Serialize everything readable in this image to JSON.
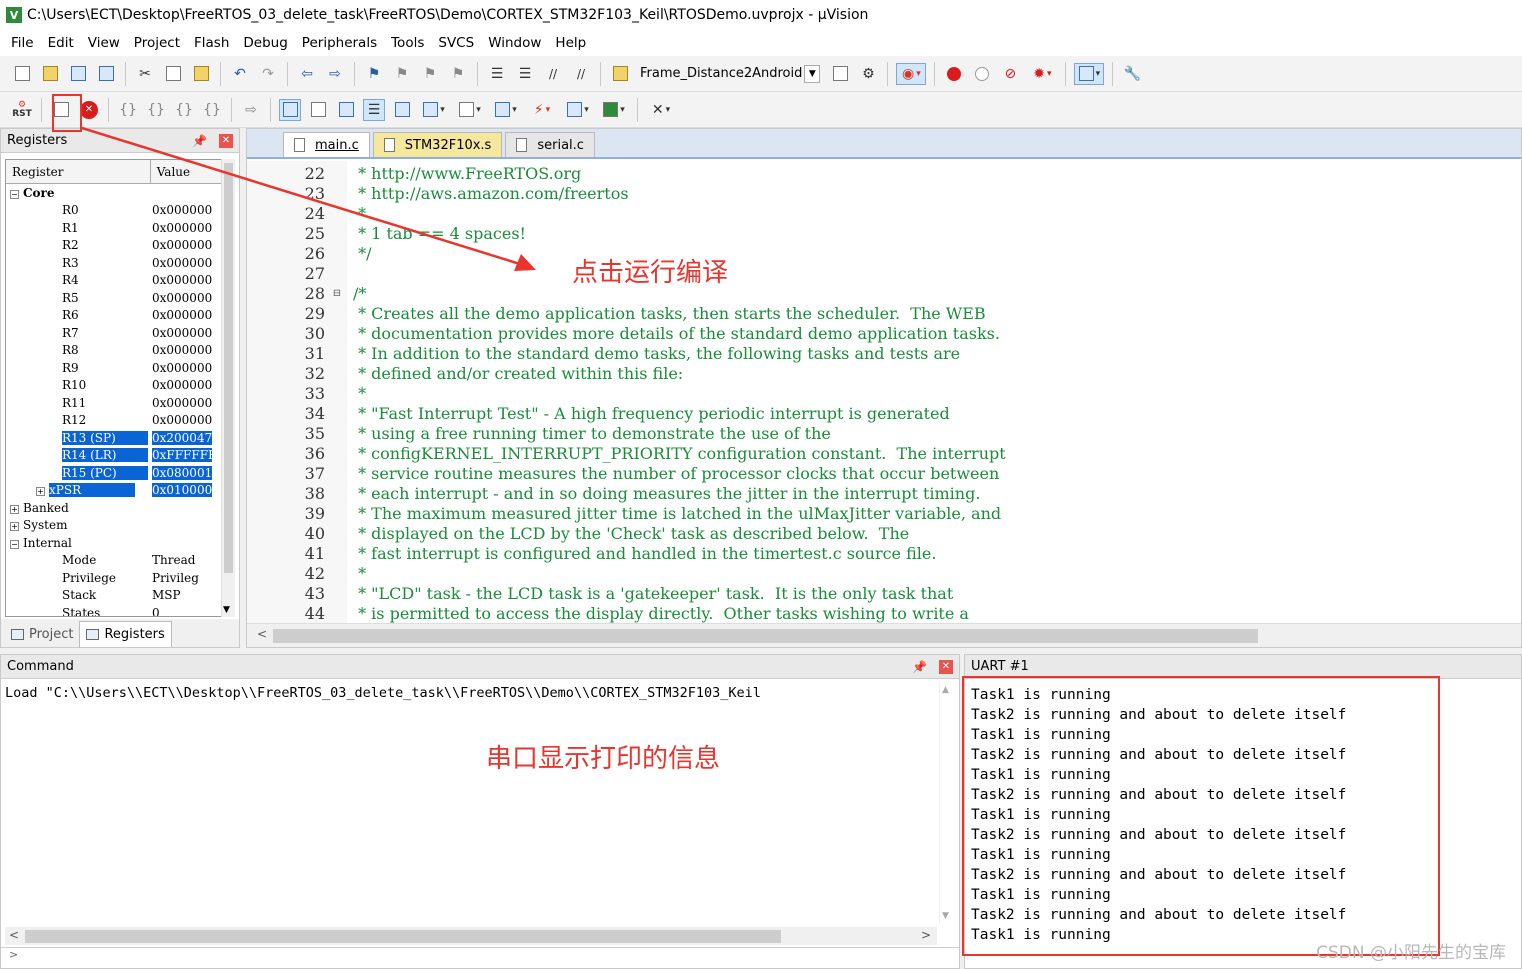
{
  "window": {
    "title": "C:\\Users\\ECT\\Desktop\\FreeRTOS_03_delete_task\\FreeRTOS\\Demo\\CORTEX_STM32F103_Keil\\RTOSDemo.uvprojx - µVision",
    "icon": "uvision-icon"
  },
  "menu": [
    "File",
    "Edit",
    "View",
    "Project",
    "Flash",
    "Debug",
    "Peripherals",
    "Tools",
    "SVCS",
    "Window",
    "Help"
  ],
  "toolbar": {
    "target": "Frame_Distance2Android",
    "rst_label": "RST"
  },
  "registers": {
    "panel_title": "Registers",
    "col_register": "Register",
    "col_value": "Value",
    "group_core": "Core",
    "core": [
      {
        "name": "R0",
        "value": "0x000000"
      },
      {
        "name": "R1",
        "value": "0x000000"
      },
      {
        "name": "R2",
        "value": "0x000000"
      },
      {
        "name": "R3",
        "value": "0x000000"
      },
      {
        "name": "R4",
        "value": "0x000000"
      },
      {
        "name": "R5",
        "value": "0x000000"
      },
      {
        "name": "R6",
        "value": "0x000000"
      },
      {
        "name": "R7",
        "value": "0x000000"
      },
      {
        "name": "R8",
        "value": "0x000000"
      },
      {
        "name": "R9",
        "value": "0x000000"
      },
      {
        "name": "R10",
        "value": "0x000000"
      },
      {
        "name": "R11",
        "value": "0x000000"
      },
      {
        "name": "R12",
        "value": "0x000000"
      },
      {
        "name": "R13 (SP)",
        "value": "0x200047"
      },
      {
        "name": "R14 (LR)",
        "value": "0xFFFFFF"
      },
      {
        "name": "R15 (PC)",
        "value": "0x080001"
      },
      {
        "name": "xPSR",
        "value": "0x010000"
      }
    ],
    "group_banked": "Banked",
    "group_system": "System",
    "group_internal": "Internal",
    "internal": [
      {
        "name": "Mode",
        "value": "Thread"
      },
      {
        "name": "Privilege",
        "value": "Privileg"
      },
      {
        "name": "Stack",
        "value": "MSP"
      },
      {
        "name": "States",
        "value": "0"
      }
    ],
    "tab_project": "Project",
    "tab_registers": "Registers"
  },
  "editor": {
    "tabs": [
      "main.c",
      "STM32F10x.s",
      "serial.c"
    ],
    "lines": [
      {
        "n": "22",
        "t": " * http://www.FreeRTOS.org"
      },
      {
        "n": "23",
        "t": " * http://aws.amazon.com/freertos"
      },
      {
        "n": "24",
        "t": " *"
      },
      {
        "n": "25",
        "t": " * 1 tab == 4 spaces!"
      },
      {
        "n": "26",
        "t": " */"
      },
      {
        "n": "27",
        "t": ""
      },
      {
        "n": "28",
        "t": "/*",
        "fold": "⊟"
      },
      {
        "n": "29",
        "t": " * Creates all the demo application tasks, then starts the scheduler.  The WEB"
      },
      {
        "n": "30",
        "t": " * documentation provides more details of the standard demo application tasks."
      },
      {
        "n": "31",
        "t": " * In addition to the standard demo tasks, the following tasks and tests are"
      },
      {
        "n": "32",
        "t": " * defined and/or created within this file:"
      },
      {
        "n": "33",
        "t": " *"
      },
      {
        "n": "34",
        "t": " * \"Fast Interrupt Test\" - A high frequency periodic interrupt is generated"
      },
      {
        "n": "35",
        "t": " * using a free running timer to demonstrate the use of the"
      },
      {
        "n": "36",
        "t": " * configKERNEL_INTERRUPT_PRIORITY configuration constant.  The interrupt"
      },
      {
        "n": "37",
        "t": " * service routine measures the number of processor clocks that occur between"
      },
      {
        "n": "38",
        "t": " * each interrupt - and in so doing measures the jitter in the interrupt timing."
      },
      {
        "n": "39",
        "t": " * The maximum measured jitter time is latched in the ulMaxJitter variable, and"
      },
      {
        "n": "40",
        "t": " * displayed on the LCD by the 'Check' task as described below.  The"
      },
      {
        "n": "41",
        "t": " * fast interrupt is configured and handled in the timertest.c source file."
      },
      {
        "n": "42",
        "t": " *"
      },
      {
        "n": "43",
        "t": " * \"LCD\" task - the LCD task is a 'gatekeeper' task.  It is the only task that"
      },
      {
        "n": "44",
        "t": " * is permitted to access the display directly.  Other tasks wishing to write a"
      }
    ]
  },
  "command": {
    "title": "Command",
    "text": "Load \"C:\\\\Users\\\\ECT\\\\Desktop\\\\FreeRTOS_03_delete_task\\\\FreeRTOS\\\\Demo\\\\CORTEX_STM32F103_Keil"
  },
  "uart": {
    "title": "UART #1",
    "lines": [
      "Task1 is running",
      "Task2 is running and about to delete itself",
      "Task1 is running",
      "Task2 is running and about to delete itself",
      "Task1 is running",
      "Task2 is running and about to delete itself",
      "Task1 is running",
      "Task2 is running and about to delete itself",
      "Task1 is running",
      "Task2 is running and about to delete itself",
      "Task1 is running",
      "Task2 is running and about to delete itself",
      "Task1 is running"
    ]
  },
  "annotations": {
    "compile_note": "点击运行编译",
    "serial_note": "串口显示打印的信息",
    "watermark": "CSDN @小阳先生的宝库",
    "color": "#e8362d"
  },
  "colors": {
    "comment": "#1a8c3a",
    "selection": "#0a64d6",
    "accent": "#e8362d"
  }
}
